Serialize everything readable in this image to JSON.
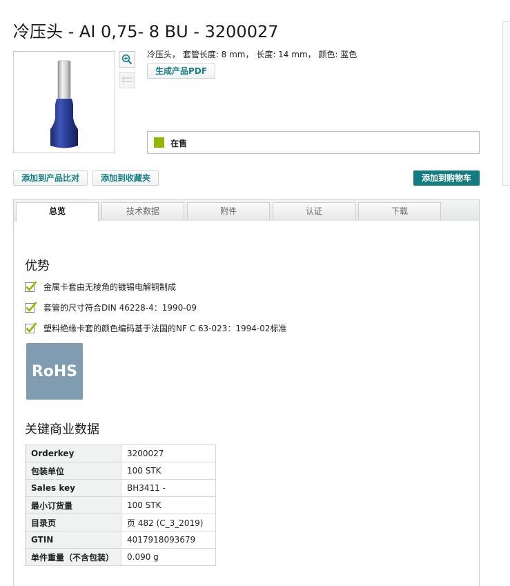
{
  "product": {
    "title": "冷压头 - AI 0,75- 8 BU - 3200027",
    "description": "冷压头， 套管长度: 8 mm， 长度: 14 mm， 颜色: 蓝色",
    "pdf_button": "生成产品PDF",
    "status": "在售",
    "status_color": "#8fb800"
  },
  "actions": {
    "compare": "添加到产品比对",
    "favorites": "添加到收藏夹",
    "cart": "添加到购物车",
    "cart_color": "#137c80"
  },
  "tabs": [
    "总览",
    "技术数据",
    "附件",
    "认证",
    "下载"
  ],
  "advantages": {
    "heading": "优势",
    "items": [
      "金属卡套由无棱角的镀锡电解铜制成",
      "套管的尺寸符合DIN 46228-4：1990-09",
      "塑料绝缘卡套的颜色编码基于法国的NF C 63-023：1994-02标准"
    ],
    "badge": "RoHS"
  },
  "commercial": {
    "heading": "关键商业数据",
    "rows": [
      {
        "key": "Orderkey",
        "value": "3200027"
      },
      {
        "key": "包装单位",
        "value": "100 STK"
      },
      {
        "key": "Sales key",
        "value": "BH3411 -"
      },
      {
        "key": "最小订货量",
        "value": "100 STK"
      },
      {
        "key": "目录页",
        "value": "页 482 (C_3_2019)"
      },
      {
        "key": "GTIN",
        "value": "4017918093679"
      },
      {
        "key": "单件重量（不含包装）",
        "value": "0.090 g"
      }
    ]
  }
}
